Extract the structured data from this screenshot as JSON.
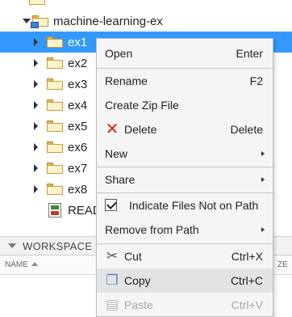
{
  "tree": {
    "root": {
      "label": "machine-learning-ex"
    },
    "items": [
      {
        "label": "ex1",
        "selected": true
      },
      {
        "label": "ex2"
      },
      {
        "label": "ex3"
      },
      {
        "label": "ex4"
      },
      {
        "label": "ex5"
      },
      {
        "label": "ex6"
      },
      {
        "label": "ex7"
      },
      {
        "label": "ex8"
      }
    ],
    "file": {
      "label": "READ"
    }
  },
  "workspace": {
    "title": "WORKSPACE",
    "col_name": "NAME",
    "col_size": "ZE"
  },
  "context_menu": {
    "open": {
      "label": "Open",
      "shortcut": "Enter"
    },
    "rename": {
      "label": "Rename",
      "shortcut": "F2"
    },
    "create_zip": {
      "label": "Create Zip File"
    },
    "delete": {
      "label": "Delete",
      "shortcut": "Delete"
    },
    "new": {
      "label": "New"
    },
    "share": {
      "label": "Share"
    },
    "indicate": {
      "label": "Indicate Files Not on Path",
      "checked": true
    },
    "remove_path": {
      "label": "Remove from Path"
    },
    "cut": {
      "label": "Cut",
      "shortcut": "Ctrl+X"
    },
    "copy": {
      "label": "Copy",
      "shortcut": "Ctrl+C"
    },
    "paste": {
      "label": "Paste",
      "shortcut": "Ctrl+V",
      "disabled": true
    }
  },
  "colors": {
    "selection": "#3399ff",
    "menu_background": "#f5f5f5",
    "delete_icon": "#e02020"
  },
  "icons": [
    "folder-icon",
    "project-folder-icon",
    "file-icon",
    "delete-icon",
    "cut-icon",
    "copy-icon",
    "paste-icon",
    "checkbox-icon",
    "submenu-arrow-icon"
  ]
}
